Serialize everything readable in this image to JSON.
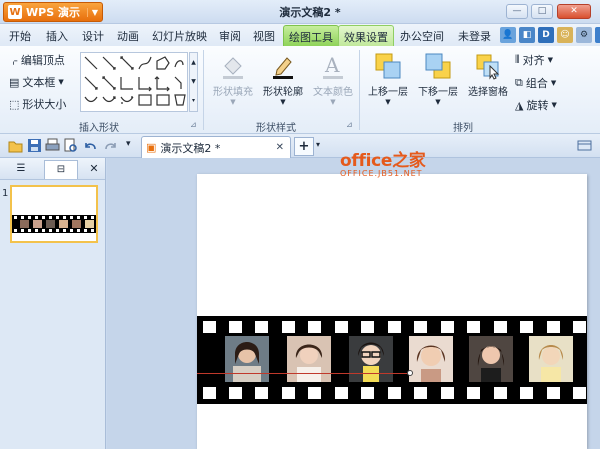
{
  "app": {
    "name": "WPS 演示",
    "doc_title": "演示文稿2 *"
  },
  "window": {
    "min": "—",
    "max": "□",
    "close": "✕"
  },
  "menu": {
    "items": [
      "开始",
      "插入",
      "设计",
      "动画",
      "幻灯片放映",
      "审阅",
      "视图"
    ],
    "active_tab": "绘图工具",
    "second_tab": "效果设置",
    "office_space": "办公空间",
    "login": "未登录"
  },
  "ribbon": {
    "edit_vertices": "编辑顶点",
    "text_box": "文本框",
    "shape_size": "形状大小",
    "insert_shapes_group": "插入形状",
    "shape_fill": "形状填充",
    "shape_outline": "形状轮廓",
    "text_color": "文本颜色",
    "shape_style_group": "形状样式",
    "bring_forward": "上移一层",
    "send_backward": "下移一层",
    "selection_pane": "选择窗格",
    "align": "对齐",
    "group": "组合",
    "rotate": "旋转",
    "arrange_group": "排列"
  },
  "toolbar": {
    "doc_tab": "演示文稿2 *",
    "new_tab": "+"
  },
  "slides_pane": {
    "slide_number": "1"
  },
  "watermark": {
    "main": "office之家",
    "sub": "OFFICE.JB51.NET"
  },
  "colors": {
    "accent_green": "#8fd35a",
    "wps_orange": "#e86f0c",
    "watermark": "#e55a1c"
  }
}
